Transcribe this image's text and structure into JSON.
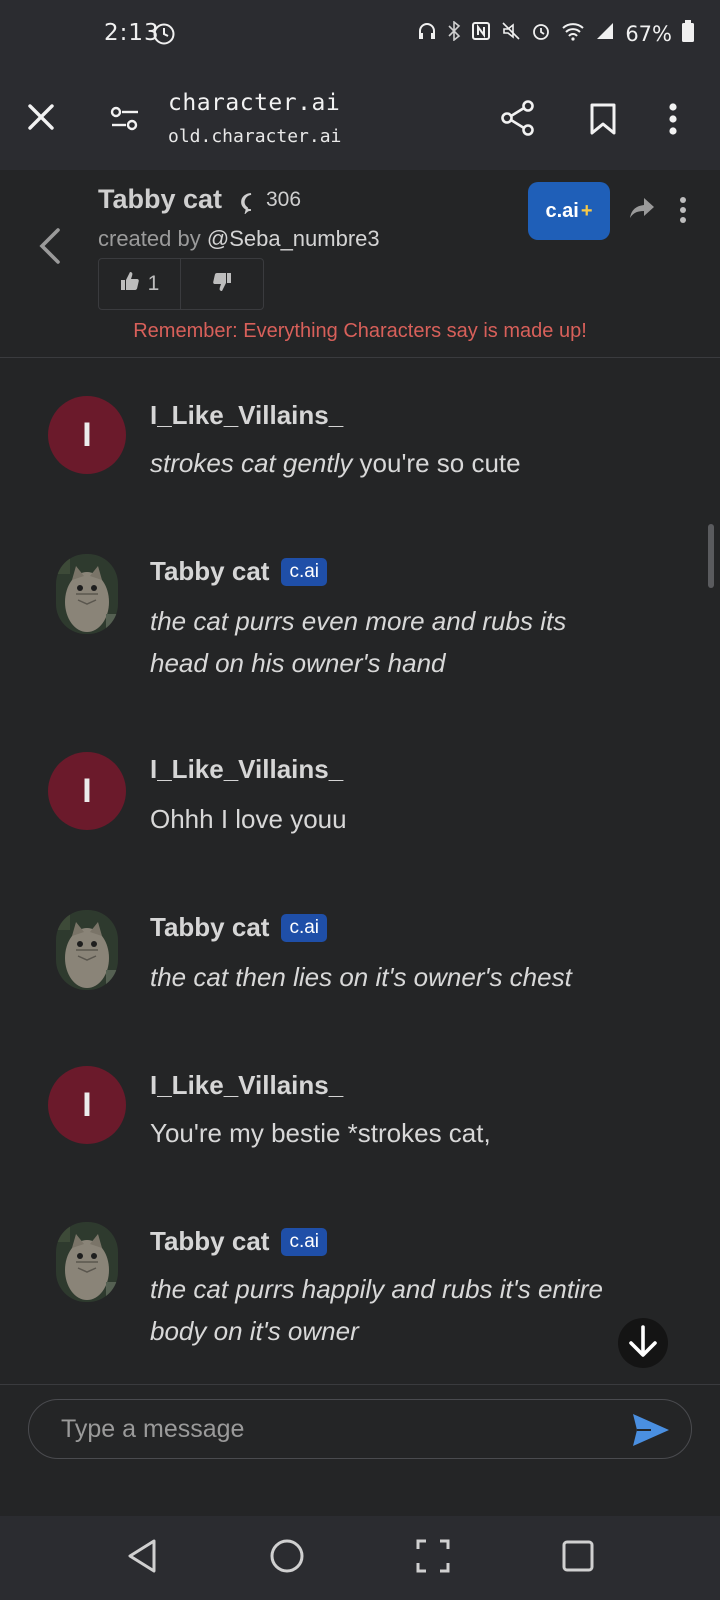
{
  "status_bar": {
    "time": "2:13",
    "battery": "67%"
  },
  "browser": {
    "title": "character.ai",
    "url": "old.character.ai"
  },
  "chat_header": {
    "name": "Tabby cat",
    "chat_count": "306",
    "created_by_label": "created by",
    "creator": "@Seba_numbre3",
    "likes": "1",
    "plus_label": "c.ai",
    "plus_symbol": "+",
    "reminder": "Remember: Everything Characters say is made up!"
  },
  "messages": [
    {
      "sender": "I_Like_Villains_",
      "avatar_letter": "I",
      "is_bot": false,
      "italic": "strokes cat gently",
      "plain": " you're so cute"
    },
    {
      "sender": "Tabby cat",
      "badge": "c.ai",
      "is_bot": true,
      "italic": "the cat purrs even more and rubs its head on his owner's hand",
      "plain": ""
    },
    {
      "sender": "I_Like_Villains_",
      "avatar_letter": "I",
      "is_bot": false,
      "italic": "",
      "plain": "Ohhh I love youu"
    },
    {
      "sender": "Tabby cat",
      "badge": "c.ai",
      "is_bot": true,
      "italic": "the cat then lies on it's owner's chest",
      "plain": ""
    },
    {
      "sender": "I_Like_Villains_",
      "avatar_letter": "I",
      "is_bot": false,
      "italic": "",
      "plain": "You're my bestie *strokes cat,"
    },
    {
      "sender": "Tabby cat",
      "badge": "c.ai",
      "is_bot": true,
      "italic": "the cat purrs happily and rubs it's entire body on it's owner",
      "plain": ""
    }
  ],
  "composer": {
    "placeholder": "Type a message"
  },
  "colors": {
    "accent": "#1f5fb8",
    "user_avatar": "#6b1a2b",
    "reminder": "#d8605a",
    "send": "#4a8fe0"
  }
}
